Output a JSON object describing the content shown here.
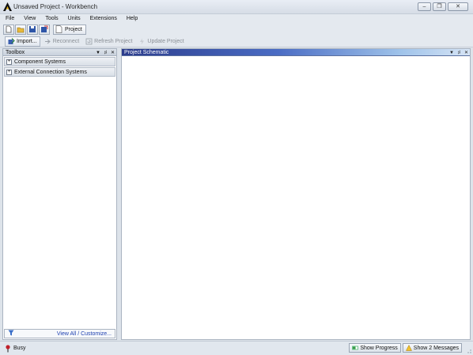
{
  "window": {
    "title": "Unsaved Project - Workbench"
  },
  "menu": {
    "items": [
      "File",
      "View",
      "Tools",
      "Units",
      "Extensions",
      "Help"
    ]
  },
  "toolbar": {
    "project_tab": "Project"
  },
  "actions": {
    "import": "Import...",
    "reconnect": "Reconnect",
    "refresh": "Refresh Project",
    "update": "Update Project"
  },
  "toolbox": {
    "title": "Toolbox",
    "groups": [
      "Component Systems",
      "External Connection Systems"
    ],
    "footer_link": "View All / Customize..."
  },
  "schematic": {
    "title": "Project Schematic"
  },
  "status": {
    "text": "Busy",
    "show_progress": "Show Progress",
    "show_messages": "Show 2 Messages"
  },
  "colors": {
    "schematic_header_start": "#2c3c8c",
    "schematic_header_end": "#d6e4f5",
    "busy_indicator": "#c0202a",
    "link": "#1d3fb0"
  }
}
